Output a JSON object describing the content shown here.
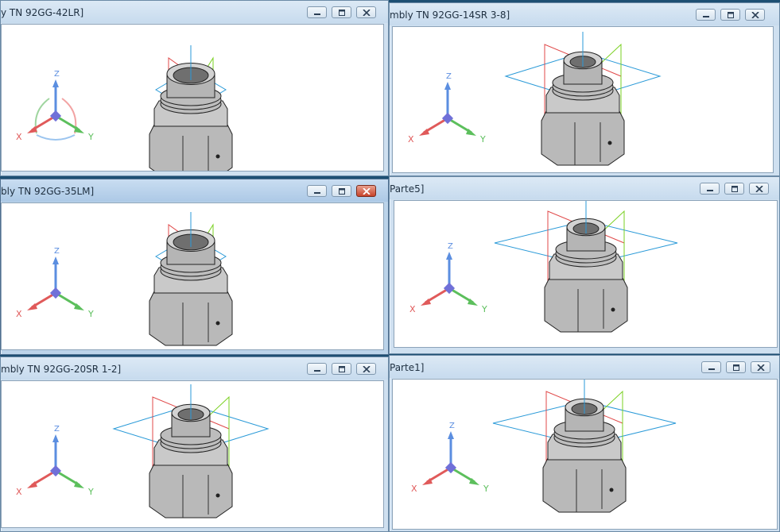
{
  "windows": [
    {
      "id": "w1",
      "title": "y TN 92GG-42LR]",
      "active": false
    },
    {
      "id": "w2",
      "title": "mbly TN 92GG-14SR 3-8]",
      "active": false
    },
    {
      "id": "w3",
      "title": "bly TN 92GG-35LM]",
      "active": true
    },
    {
      "id": "w4",
      "title": "Parte5]",
      "active": false
    },
    {
      "id": "w5",
      "title": "mbly TN 92GG-20SR 1-2]",
      "active": false
    },
    {
      "id": "w6",
      "title": "Parte1]",
      "active": false
    }
  ],
  "triad": {
    "z_label": "Z",
    "x_label": "X",
    "y_label": "Y"
  },
  "colors": {
    "z_axis": "#5b8ee0",
    "x_axis": "#e05a5a",
    "y_axis": "#5cbf5c",
    "origin": "#7070d8",
    "plane_blue": "#2a9ad8",
    "plane_red": "#e04848",
    "plane_green": "#7ad020",
    "model_body": "#b9b9b9",
    "model_dark": "#6f6f6f"
  }
}
